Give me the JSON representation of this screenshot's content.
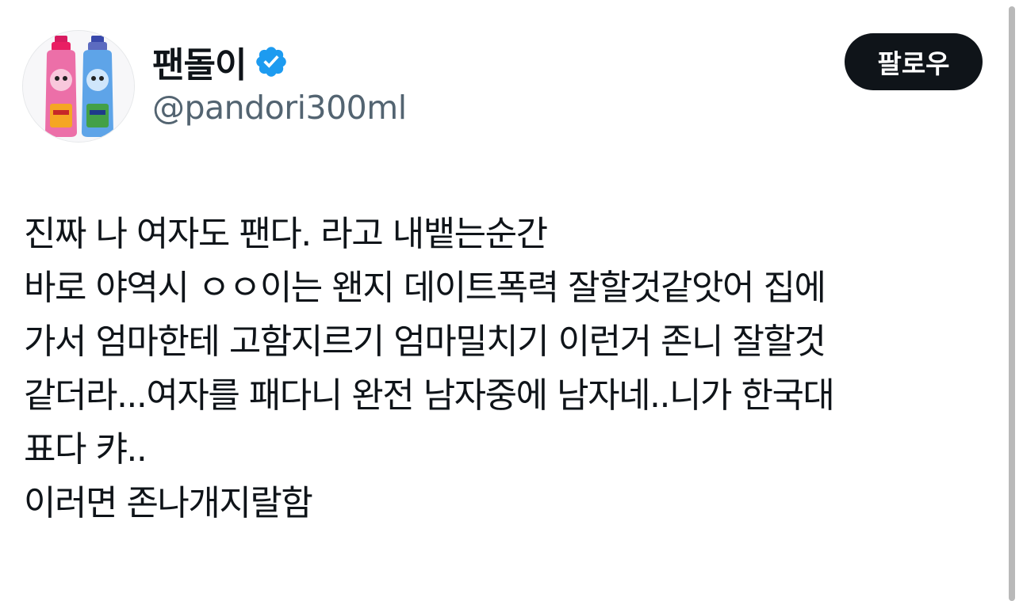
{
  "user": {
    "display_name": "팬돌이",
    "handle": "@pandori300ml",
    "verified": true,
    "verified_color": "#1d9bf0"
  },
  "actions": {
    "follow_label": "팔로우"
  },
  "tweet": {
    "lines": [
      "진짜 나 여자도 팬다. 라고 내뱉는순간",
      "바로 야역시 ㅇㅇ이는 왠지 데이트폭력 잘할것같앗어 집에",
      "가서 엄마한테 고함지르기 엄마밀치기 이런거 존니 잘할것",
      "같더라...여자를 패다니 완전 남자중에 남자네..니가 한국대",
      "표다 캬..",
      "이러면 존나개지랄함"
    ]
  },
  "icons": {
    "verified": "verified-badge-icon",
    "avatar": "profile-avatar"
  }
}
